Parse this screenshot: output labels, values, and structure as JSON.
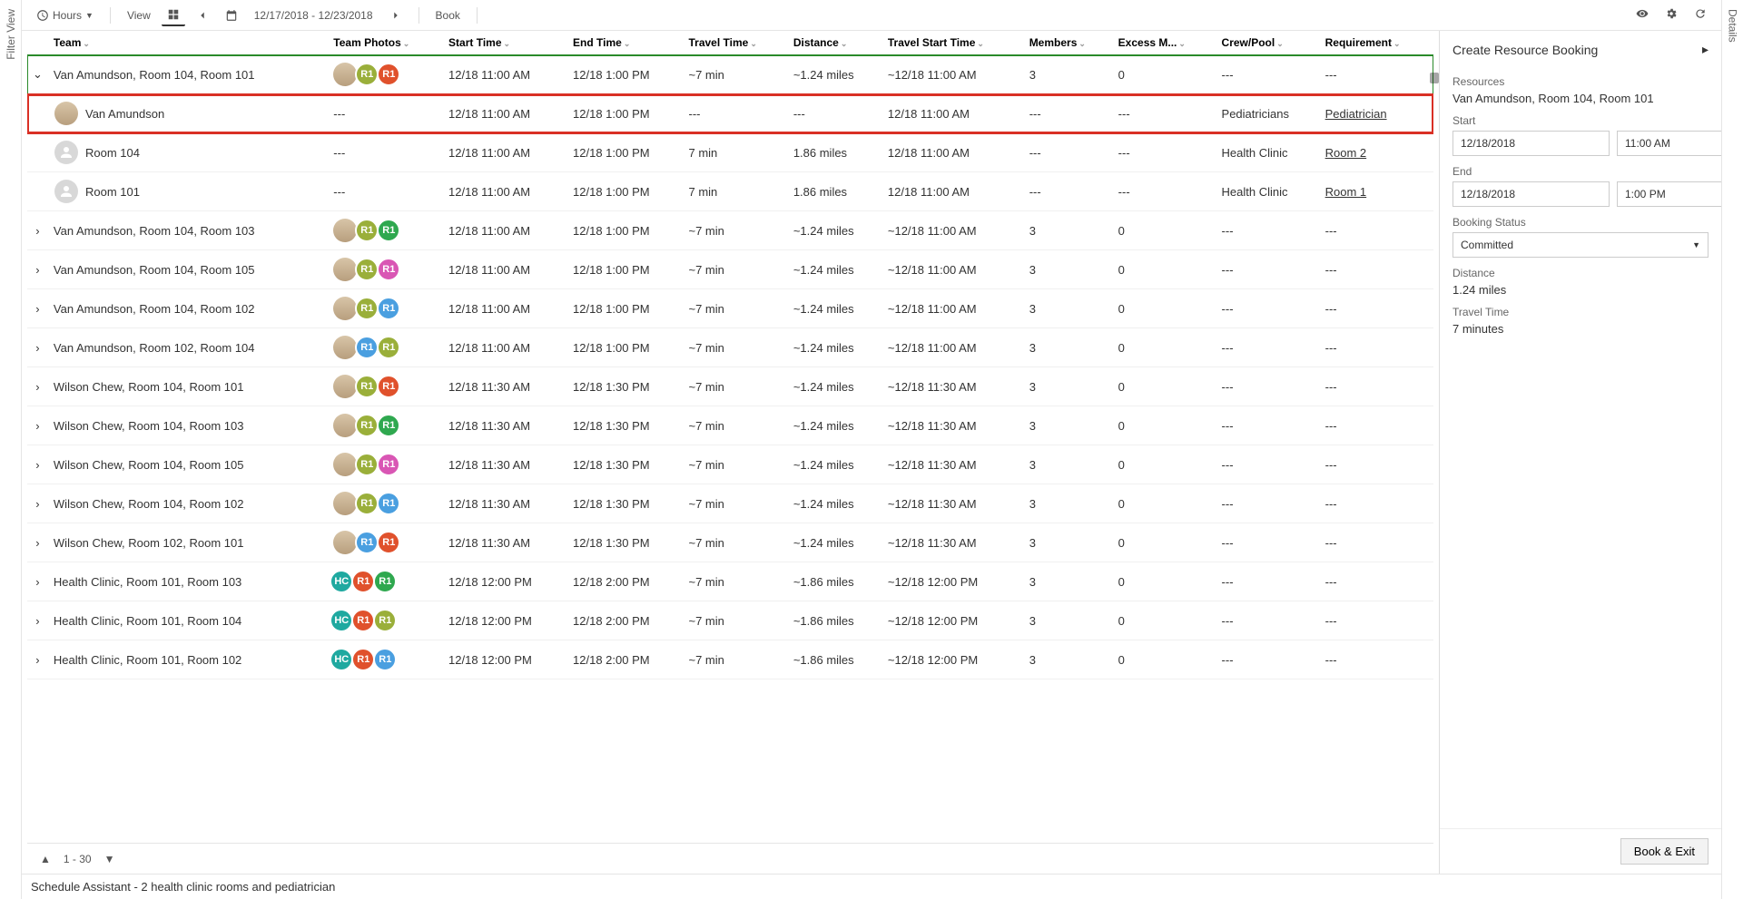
{
  "leftTab": "Filter View",
  "rightTab": "Details",
  "toolbar": {
    "hours": "Hours",
    "view": "View",
    "dateRange": "12/17/2018 - 12/23/2018",
    "book": "Book"
  },
  "columns": [
    "Team",
    "Team Photos",
    "Start Time",
    "End Time",
    "Travel Time",
    "Distance",
    "Travel Start Time",
    "Members",
    "Excess M...",
    "Crew/Pool",
    "Requirement"
  ],
  "badgeColors": {
    "olive": "#9aaf3a",
    "orange": "#e0512c",
    "green": "#2fa84f",
    "pink": "#d956b4",
    "blue": "#4a9fe0",
    "teal": "#1fa9a0"
  },
  "rows": [
    {
      "expand": "down",
      "selected": true,
      "team": "Van Amundson, Room 104, Room 101",
      "photos": [
        {
          "t": "person"
        },
        {
          "t": "badge",
          "c": "olive",
          "l": "R1"
        },
        {
          "t": "badge",
          "c": "orange",
          "l": "R1"
        }
      ],
      "start": "12/18 11:00 AM",
      "end": "12/18 1:00 PM",
      "travel": "~7 min",
      "dist": "~1.24 miles",
      "tstart": "~12/18 11:00 AM",
      "members": "3",
      "excess": "0",
      "crew": "---",
      "req": "---"
    },
    {
      "child": true,
      "highlight": true,
      "team": "Van Amundson",
      "photos": [
        {
          "t": "person"
        }
      ],
      "tp": "---",
      "start": "12/18 11:00 AM",
      "end": "12/18 1:00 PM",
      "travel": "---",
      "dist": "---",
      "tstart": "12/18 11:00 AM",
      "members": "---",
      "excess": "---",
      "crew": "Pediatricians",
      "req": "Pediatrician",
      "reqLink": true
    },
    {
      "child": true,
      "team": "Room 104",
      "photos": [
        {
          "t": "blank"
        }
      ],
      "tp": "---",
      "start": "12/18 11:00 AM",
      "end": "12/18 1:00 PM",
      "travel": "7 min",
      "dist": "1.86 miles",
      "tstart": "12/18 11:00 AM",
      "members": "---",
      "excess": "---",
      "crew": "Health Clinic",
      "req": "Room 2",
      "reqLink": true
    },
    {
      "child": true,
      "team": "Room 101",
      "photos": [
        {
          "t": "blank"
        }
      ],
      "tp": "---",
      "start": "12/18 11:00 AM",
      "end": "12/18 1:00 PM",
      "travel": "7 min",
      "dist": "1.86 miles",
      "tstart": "12/18 11:00 AM",
      "members": "---",
      "excess": "---",
      "crew": "Health Clinic",
      "req": "Room 1",
      "reqLink": true
    },
    {
      "expand": "right",
      "team": "Van Amundson, Room 104, Room 103",
      "photos": [
        {
          "t": "person"
        },
        {
          "t": "badge",
          "c": "olive",
          "l": "R1"
        },
        {
          "t": "badge",
          "c": "green",
          "l": "R1"
        }
      ],
      "start": "12/18 11:00 AM",
      "end": "12/18 1:00 PM",
      "travel": "~7 min",
      "dist": "~1.24 miles",
      "tstart": "~12/18 11:00 AM",
      "members": "3",
      "excess": "0",
      "crew": "---",
      "req": "---"
    },
    {
      "expand": "right",
      "team": "Van Amundson, Room 104, Room 105",
      "photos": [
        {
          "t": "person"
        },
        {
          "t": "badge",
          "c": "olive",
          "l": "R1"
        },
        {
          "t": "badge",
          "c": "pink",
          "l": "R1"
        }
      ],
      "start": "12/18 11:00 AM",
      "end": "12/18 1:00 PM",
      "travel": "~7 min",
      "dist": "~1.24 miles",
      "tstart": "~12/18 11:00 AM",
      "members": "3",
      "excess": "0",
      "crew": "---",
      "req": "---"
    },
    {
      "expand": "right",
      "team": "Van Amundson, Room 104, Room 102",
      "photos": [
        {
          "t": "person"
        },
        {
          "t": "badge",
          "c": "olive",
          "l": "R1"
        },
        {
          "t": "badge",
          "c": "blue",
          "l": "R1"
        }
      ],
      "start": "12/18 11:00 AM",
      "end": "12/18 1:00 PM",
      "travel": "~7 min",
      "dist": "~1.24 miles",
      "tstart": "~12/18 11:00 AM",
      "members": "3",
      "excess": "0",
      "crew": "---",
      "req": "---"
    },
    {
      "expand": "right",
      "team": "Van Amundson, Room 102, Room 104",
      "photos": [
        {
          "t": "person"
        },
        {
          "t": "badge",
          "c": "blue",
          "l": "R1"
        },
        {
          "t": "badge",
          "c": "olive",
          "l": "R1"
        }
      ],
      "start": "12/18 11:00 AM",
      "end": "12/18 1:00 PM",
      "travel": "~7 min",
      "dist": "~1.24 miles",
      "tstart": "~12/18 11:00 AM",
      "members": "3",
      "excess": "0",
      "crew": "---",
      "req": "---"
    },
    {
      "expand": "right",
      "team": "Wilson Chew, Room 104, Room 101",
      "photos": [
        {
          "t": "person"
        },
        {
          "t": "badge",
          "c": "olive",
          "l": "R1"
        },
        {
          "t": "badge",
          "c": "orange",
          "l": "R1"
        }
      ],
      "start": "12/18 11:30 AM",
      "end": "12/18 1:30 PM",
      "travel": "~7 min",
      "dist": "~1.24 miles",
      "tstart": "~12/18 11:30 AM",
      "members": "3",
      "excess": "0",
      "crew": "---",
      "req": "---"
    },
    {
      "expand": "right",
      "team": "Wilson Chew, Room 104, Room 103",
      "photos": [
        {
          "t": "person"
        },
        {
          "t": "badge",
          "c": "olive",
          "l": "R1"
        },
        {
          "t": "badge",
          "c": "green",
          "l": "R1"
        }
      ],
      "start": "12/18 11:30 AM",
      "end": "12/18 1:30 PM",
      "travel": "~7 min",
      "dist": "~1.24 miles",
      "tstart": "~12/18 11:30 AM",
      "members": "3",
      "excess": "0",
      "crew": "---",
      "req": "---"
    },
    {
      "expand": "right",
      "team": "Wilson Chew, Room 104, Room 105",
      "photos": [
        {
          "t": "person"
        },
        {
          "t": "badge",
          "c": "olive",
          "l": "R1"
        },
        {
          "t": "badge",
          "c": "pink",
          "l": "R1"
        }
      ],
      "start": "12/18 11:30 AM",
      "end": "12/18 1:30 PM",
      "travel": "~7 min",
      "dist": "~1.24 miles",
      "tstart": "~12/18 11:30 AM",
      "members": "3",
      "excess": "0",
      "crew": "---",
      "req": "---"
    },
    {
      "expand": "right",
      "team": "Wilson Chew, Room 104, Room 102",
      "photos": [
        {
          "t": "person"
        },
        {
          "t": "badge",
          "c": "olive",
          "l": "R1"
        },
        {
          "t": "badge",
          "c": "blue",
          "l": "R1"
        }
      ],
      "start": "12/18 11:30 AM",
      "end": "12/18 1:30 PM",
      "travel": "~7 min",
      "dist": "~1.24 miles",
      "tstart": "~12/18 11:30 AM",
      "members": "3",
      "excess": "0",
      "crew": "---",
      "req": "---"
    },
    {
      "expand": "right",
      "team": "Wilson Chew, Room 102, Room 101",
      "photos": [
        {
          "t": "person"
        },
        {
          "t": "badge",
          "c": "blue",
          "l": "R1"
        },
        {
          "t": "badge",
          "c": "orange",
          "l": "R1"
        }
      ],
      "start": "12/18 11:30 AM",
      "end": "12/18 1:30 PM",
      "travel": "~7 min",
      "dist": "~1.24 miles",
      "tstart": "~12/18 11:30 AM",
      "members": "3",
      "excess": "0",
      "crew": "---",
      "req": "---"
    },
    {
      "expand": "right",
      "team": "Health Clinic, Room 101, Room 103",
      "photos": [
        {
          "t": "badge",
          "c": "teal",
          "l": "HC"
        },
        {
          "t": "badge",
          "c": "orange",
          "l": "R1"
        },
        {
          "t": "badge",
          "c": "green",
          "l": "R1"
        }
      ],
      "start": "12/18 12:00 PM",
      "end": "12/18 2:00 PM",
      "travel": "~7 min",
      "dist": "~1.86 miles",
      "tstart": "~12/18 12:00 PM",
      "members": "3",
      "excess": "0",
      "crew": "---",
      "req": "---"
    },
    {
      "expand": "right",
      "team": "Health Clinic, Room 101, Room 104",
      "photos": [
        {
          "t": "badge",
          "c": "teal",
          "l": "HC"
        },
        {
          "t": "badge",
          "c": "orange",
          "l": "R1"
        },
        {
          "t": "badge",
          "c": "olive",
          "l": "R1"
        }
      ],
      "start": "12/18 12:00 PM",
      "end": "12/18 2:00 PM",
      "travel": "~7 min",
      "dist": "~1.86 miles",
      "tstart": "~12/18 12:00 PM",
      "members": "3",
      "excess": "0",
      "crew": "---",
      "req": "---"
    },
    {
      "expand": "right",
      "team": "Health Clinic, Room 101, Room 102",
      "photos": [
        {
          "t": "badge",
          "c": "teal",
          "l": "HC"
        },
        {
          "t": "badge",
          "c": "orange",
          "l": "R1"
        },
        {
          "t": "badge",
          "c": "blue",
          "l": "R1"
        }
      ],
      "start": "12/18 12:00 PM",
      "end": "12/18 2:00 PM",
      "travel": "~7 min",
      "dist": "~1.86 miles",
      "tstart": "~12/18 12:00 PM",
      "members": "3",
      "excess": "0",
      "crew": "---",
      "req": "---"
    }
  ],
  "pager": "1 - 30",
  "statusBar": "Schedule Assistant - 2 health clinic rooms and pediatrician",
  "details": {
    "title": "Create Resource Booking",
    "resourcesLabel": "Resources",
    "resourcesValue": "Van Amundson, Room 104, Room 101",
    "startLabel": "Start",
    "startDate": "12/18/2018",
    "startTime": "11:00 AM",
    "endLabel": "End",
    "endDate": "12/18/2018",
    "endTime": "1:00 PM",
    "bookingStatusLabel": "Booking Status",
    "bookingStatusValue": "Committed",
    "distanceLabel": "Distance",
    "distanceValue": "1.24 miles",
    "travelTimeLabel": "Travel Time",
    "travelTimeValue": "7 minutes",
    "bookExit": "Book & Exit"
  }
}
